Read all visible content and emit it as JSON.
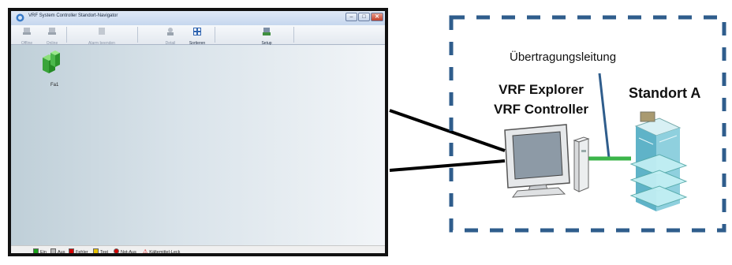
{
  "window": {
    "title": "VRF System Controller Standort-Navigator"
  },
  "toolbar": {
    "items": [
      {
        "label": "Offline",
        "enabled": false
      },
      {
        "label": "Online",
        "enabled": false
      },
      {
        "label": "Alarm beenden",
        "enabled": false
      },
      {
        "label": "Detail",
        "enabled": false
      },
      {
        "label": "Sortieren",
        "enabled": true
      },
      {
        "label": "Setup",
        "enabled": true
      }
    ]
  },
  "workarea": {
    "site_icon_label": "Fa1"
  },
  "status_legend": [
    {
      "label": "Ein",
      "color": "#1aa31a"
    },
    {
      "label": "Aus",
      "color": "#b8b8b8"
    },
    {
      "label": "Fehler",
      "color": "#d40000"
    },
    {
      "label": "Test",
      "color": "#e6c200"
    },
    {
      "label": "Not-Aus",
      "color": "#d40000"
    },
    {
      "label": "Kältemittel-Leck",
      "color": "#d40000"
    }
  ],
  "diagram": {
    "line_label": "Übertragungsleitung",
    "controller_line1": "VRF Explorer",
    "controller_line2": "VRF Controller",
    "site_label": "Standort A",
    "dash_color": "#2f5d8c",
    "cable_color": "#3bb54a",
    "pointer_color": "#2f5d8c"
  }
}
